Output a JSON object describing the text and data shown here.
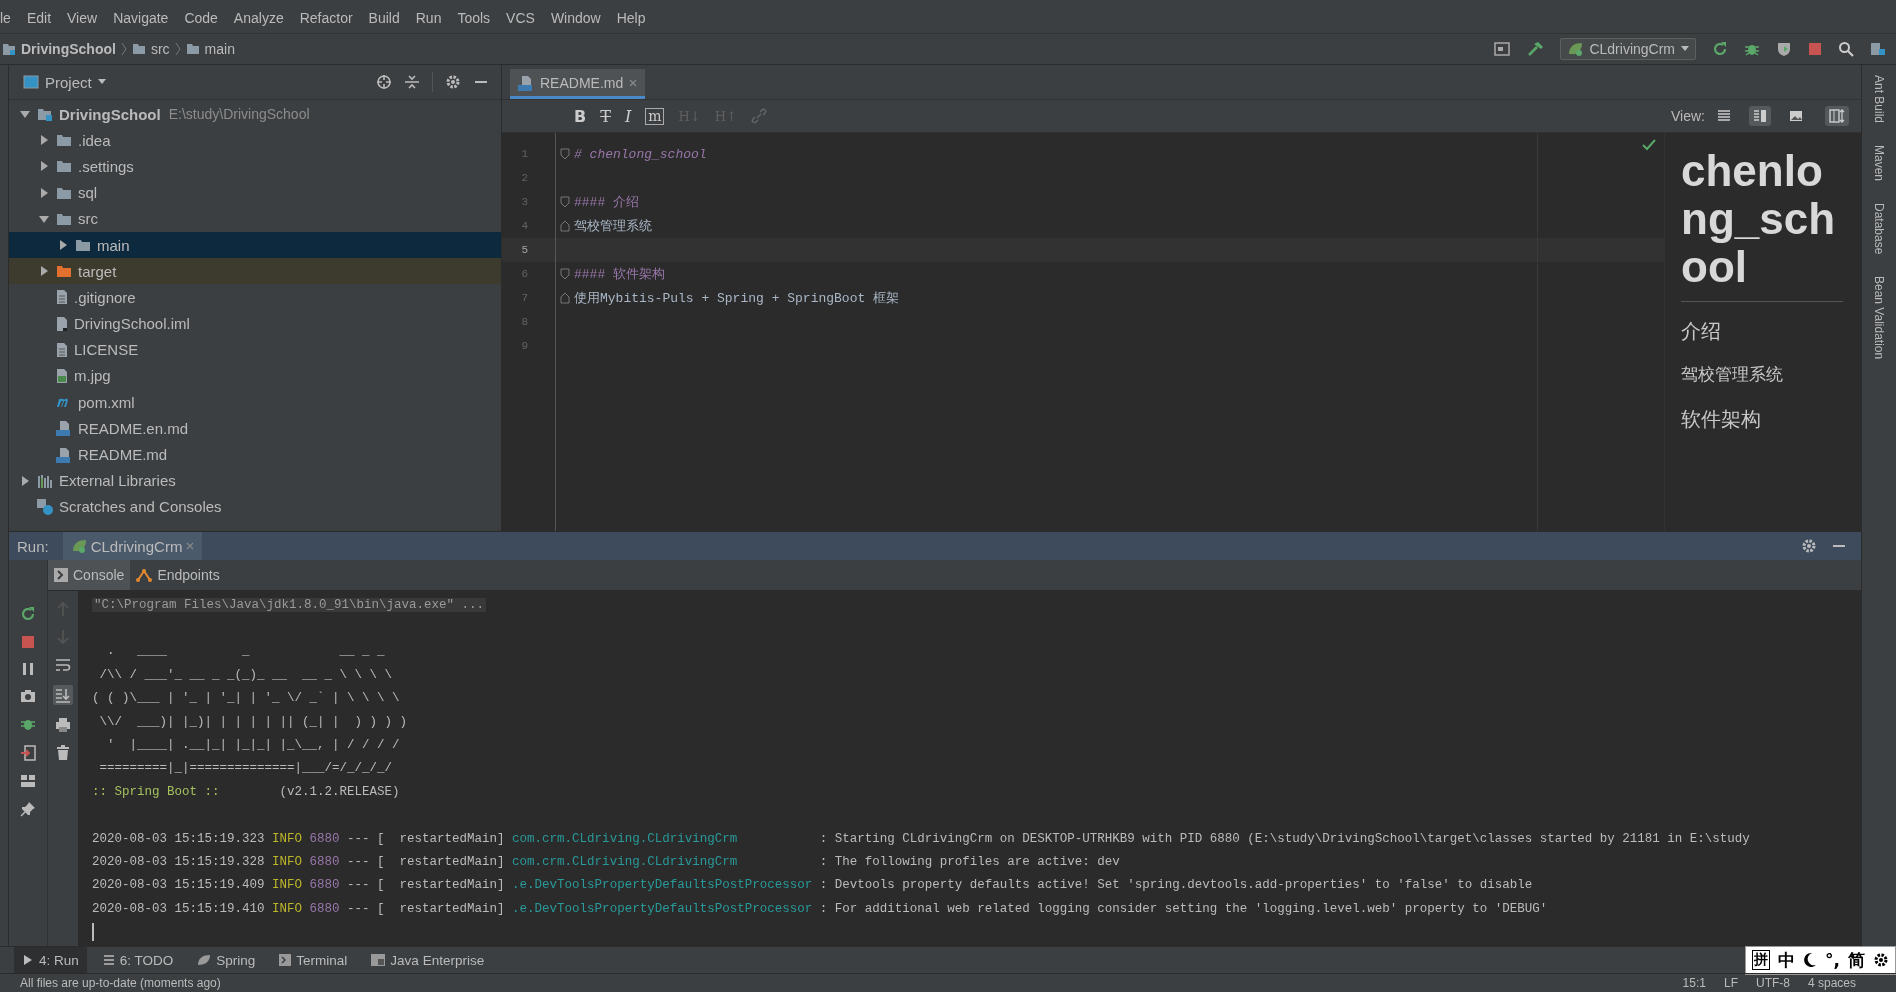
{
  "menu": [
    "le",
    "Edit",
    "View",
    "Navigate",
    "Code",
    "Analyze",
    "Refactor",
    "Build",
    "Run",
    "Tools",
    "VCS",
    "Window",
    "Help"
  ],
  "breadcrumb": [
    "DrivingSchool",
    "src",
    "main"
  ],
  "run_config": "CLdrivingCrm",
  "project": {
    "title": "Project",
    "tree": [
      {
        "label": "DrivingSchool",
        "path": "E:\\study\\DrivingSchool",
        "kind": "module",
        "expanded": true,
        "selected": false,
        "children": [
          {
            "label": ".idea",
            "kind": "folder",
            "expanded": false,
            "selected": false
          },
          {
            "label": ".settings",
            "kind": "folder",
            "expanded": false,
            "selected": false
          },
          {
            "label": "sql",
            "kind": "folder",
            "expanded": false,
            "selected": false
          },
          {
            "label": "src",
            "kind": "folder",
            "expanded": true,
            "selected": false,
            "children": [
              {
                "label": "main",
                "kind": "folder",
                "expanded": false,
                "selected": true
              }
            ]
          },
          {
            "label": "target",
            "kind": "excluded",
            "expanded": false,
            "selected": false
          },
          {
            "label": ".gitignore",
            "kind": "file",
            "selected": false
          },
          {
            "label": "DrivingSchool.iml",
            "kind": "iml",
            "selected": false
          },
          {
            "label": "LICENSE",
            "kind": "file",
            "selected": false
          },
          {
            "label": "m.jpg",
            "kind": "image",
            "selected": false
          },
          {
            "label": "pom.xml",
            "kind": "maven",
            "selected": false
          },
          {
            "label": "README.en.md",
            "kind": "markdown",
            "selected": false
          },
          {
            "label": "README.md",
            "kind": "markdown",
            "selected": false
          }
        ]
      },
      {
        "label": "External Libraries",
        "kind": "libraries",
        "expanded": false,
        "selected": false
      },
      {
        "label": "Scratches and Consoles",
        "kind": "scratches",
        "selected": false
      }
    ]
  },
  "editor": {
    "tabs": [
      {
        "label": "README.md",
        "selected": true
      }
    ],
    "format_tools": [
      {
        "label": "B",
        "kind": "bold",
        "disabled": false
      },
      {
        "label": "T",
        "kind": "strike",
        "disabled": false
      },
      {
        "label": "I",
        "kind": "italic",
        "disabled": false
      },
      {
        "label": "m",
        "kind": "code",
        "disabled": false
      },
      {
        "label": "H↓",
        "kind": "header",
        "disabled": true
      },
      {
        "label": "H↑",
        "kind": "header",
        "disabled": true
      }
    ],
    "view_label": "View:",
    "view_modes": [
      {
        "kind": "editor",
        "selected": false
      },
      {
        "kind": "split",
        "selected": true
      },
      {
        "kind": "preview",
        "selected": false
      }
    ],
    "scroll_sync": true,
    "lines": [
      {
        "number": "1",
        "kind": "h1",
        "text": "# chenlong_school",
        "fold_open": true,
        "current": false
      },
      {
        "number": "2",
        "kind": "blank",
        "current": false
      },
      {
        "number": "3",
        "kind": "h4",
        "text": "#### 介绍",
        "fold_open": true,
        "current": false
      },
      {
        "number": "4",
        "kind": "plain",
        "text": "驾校管理系统",
        "fold_open": false,
        "current": false
      },
      {
        "number": "5",
        "kind": "blank",
        "current": true
      },
      {
        "number": "6",
        "kind": "h4",
        "text": "#### 软件架构",
        "fold_open": true,
        "current": false
      },
      {
        "number": "7",
        "kind": "plain",
        "text": "使用Mybitis-Puls + Spring + SpringBoot 框架",
        "fold_open": false,
        "current": false
      },
      {
        "number": "8",
        "kind": "blank",
        "current": false
      },
      {
        "number": "9",
        "kind": "blank",
        "current": false
      }
    ],
    "preview": [
      {
        "kind": "h1",
        "text": "chenlong_school"
      },
      {
        "kind": "h4",
        "text": "介绍"
      },
      {
        "kind": "p",
        "text": "驾校管理系统"
      },
      {
        "kind": "h4",
        "text": "软件架构"
      }
    ]
  },
  "right_tools": [
    "Ant Build",
    "Maven",
    "Database",
    "Bean Validation"
  ],
  "run": {
    "label": "Run:",
    "tabs": [
      {
        "label": "CLdrivingCrm",
        "selected": true
      }
    ],
    "console_tabs": [
      {
        "label": "Console",
        "kind": "console",
        "selected": true
      },
      {
        "label": "Endpoints",
        "kind": "endpoints",
        "selected": false
      }
    ],
    "scroll_to_end": true,
    "command": "\"C:\\Program Files\\Java\\jdk1.8.0_91\\bin\\java.exe\" ...",
    "banner": [
      "  .   ____          _            __ _ _",
      " /\\\\ / ___'_ __ _ _(_)_ __  __ _ \\ \\ \\ \\",
      "( ( )\\___ | '_ | '_| | '_ \\/ _` | \\ \\ \\ \\",
      " \\\\/  ___)| |_)| | | | | || (_| |  ) ) ) )",
      "  '  |____| .__|_| |_|_| |_\\__, | / / / /",
      " =========|_|==============|___/=/_/_/_/"
    ],
    "banner_label": ":: Spring Boot ::",
    "banner_version": "(v2.1.2.RELEASE)",
    "logs": [
      {
        "time": "2020-08-03 15:15:19.323",
        "level": "INFO",
        "pid": "6880",
        "sep": "---",
        "thread": "[  restartedMain]",
        "logger": "com.crm.CLdriving.CLdrivingCrm",
        "message": ": Starting CLdrivingCrm on DESKTOP-UTRHKB9 with PID 6880 (E:\\study\\DrivingSchool\\target\\classes started by 21181 in E:\\study"
      },
      {
        "time": "2020-08-03 15:15:19.328",
        "level": "INFO",
        "pid": "6880",
        "sep": "---",
        "thread": "[  restartedMain]",
        "logger": "com.crm.CLdriving.CLdrivingCrm",
        "message": ": The following profiles are active: dev"
      },
      {
        "time": "2020-08-03 15:15:19.409",
        "level": "INFO",
        "pid": "6880",
        "sep": "---",
        "thread": "[  restartedMain]",
        "logger": ".e.DevToolsPropertyDefaultsPostProcessor",
        "message": ": Devtools property defaults active! Set 'spring.devtools.add-properties' to 'false' to disable"
      },
      {
        "time": "2020-08-03 15:15:19.410",
        "level": "INFO",
        "pid": "6880",
        "sep": "---",
        "thread": "[  restartedMain]",
        "logger": ".e.DevToolsPropertyDefaultsPostProcessor",
        "message": ": For additional web related logging consider setting the 'logging.level.web' property to 'DEBUG'"
      }
    ]
  },
  "bottom_tabs": [
    {
      "label": "4: Run",
      "kind": "run",
      "selected": true
    },
    {
      "label": "6: TODO",
      "kind": "todo",
      "selected": false
    },
    {
      "label": "Spring",
      "kind": "spring",
      "selected": false
    },
    {
      "label": "Terminal",
      "kind": "terminal",
      "selected": false
    },
    {
      "label": "Java Enterprise",
      "kind": "enterprise",
      "selected": false
    }
  ],
  "ime": [
    "拼",
    "中",
    "°,",
    "简"
  ],
  "status": {
    "message": "All files are up-to-date (moments ago)",
    "position": "15:1",
    "line_ending": "LF",
    "encoding": "UTF-8",
    "indent": "4 spaces"
  }
}
